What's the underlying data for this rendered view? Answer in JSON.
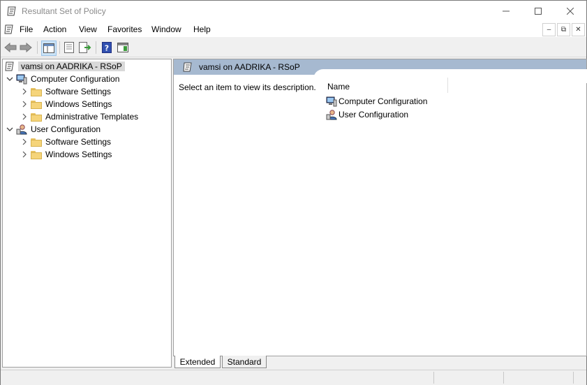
{
  "window": {
    "title": "Resultant Set of Policy"
  },
  "menubar": {
    "items": [
      "File",
      "Action",
      "View",
      "Favorites",
      "Window",
      "Help"
    ]
  },
  "tree": {
    "root": "vamsi on AADRIKA - RSoP",
    "computer_config": "Computer Configuration",
    "computer_children": [
      "Software Settings",
      "Windows Settings",
      "Administrative Templates"
    ],
    "user_config": "User Configuration",
    "user_children": [
      "Software Settings",
      "Windows Settings"
    ]
  },
  "right_pane": {
    "header": "vamsi on AADRIKA - RSoP",
    "description": "Select an item to view its description.",
    "column_name": "Name",
    "items": [
      "Computer Configuration",
      "User Configuration"
    ]
  },
  "tabs": [
    "Extended",
    "Standard"
  ]
}
